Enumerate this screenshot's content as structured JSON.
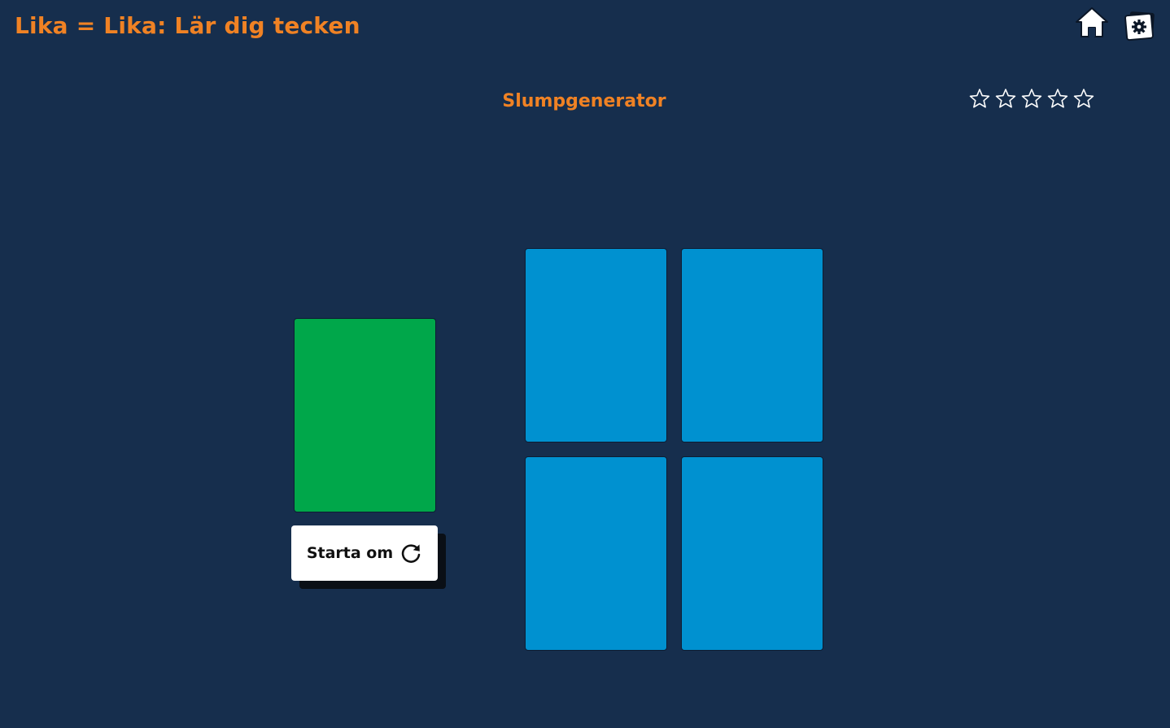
{
  "header": {
    "app_title": "Lika = Lika: Lär dig tecken",
    "home_icon": "home-icon",
    "settings_icon": "gear-icon"
  },
  "game": {
    "title": "Slumpgenerator",
    "stars": {
      "total": 5,
      "filled": 0,
      "icon": "star-outline-icon"
    }
  },
  "cards": {
    "main_card": {
      "color": "#00a74a"
    },
    "grid_cards": [
      {
        "color": "#0091d0"
      },
      {
        "color": "#0091d0"
      },
      {
        "color": "#0091d0"
      },
      {
        "color": "#0091d0"
      }
    ]
  },
  "controls": {
    "restart_label": "Starta om",
    "restart_icon": "refresh-icon"
  },
  "colors": {
    "background": "#162e4d",
    "accent": "#f08224",
    "button_bg": "#ffffff"
  }
}
